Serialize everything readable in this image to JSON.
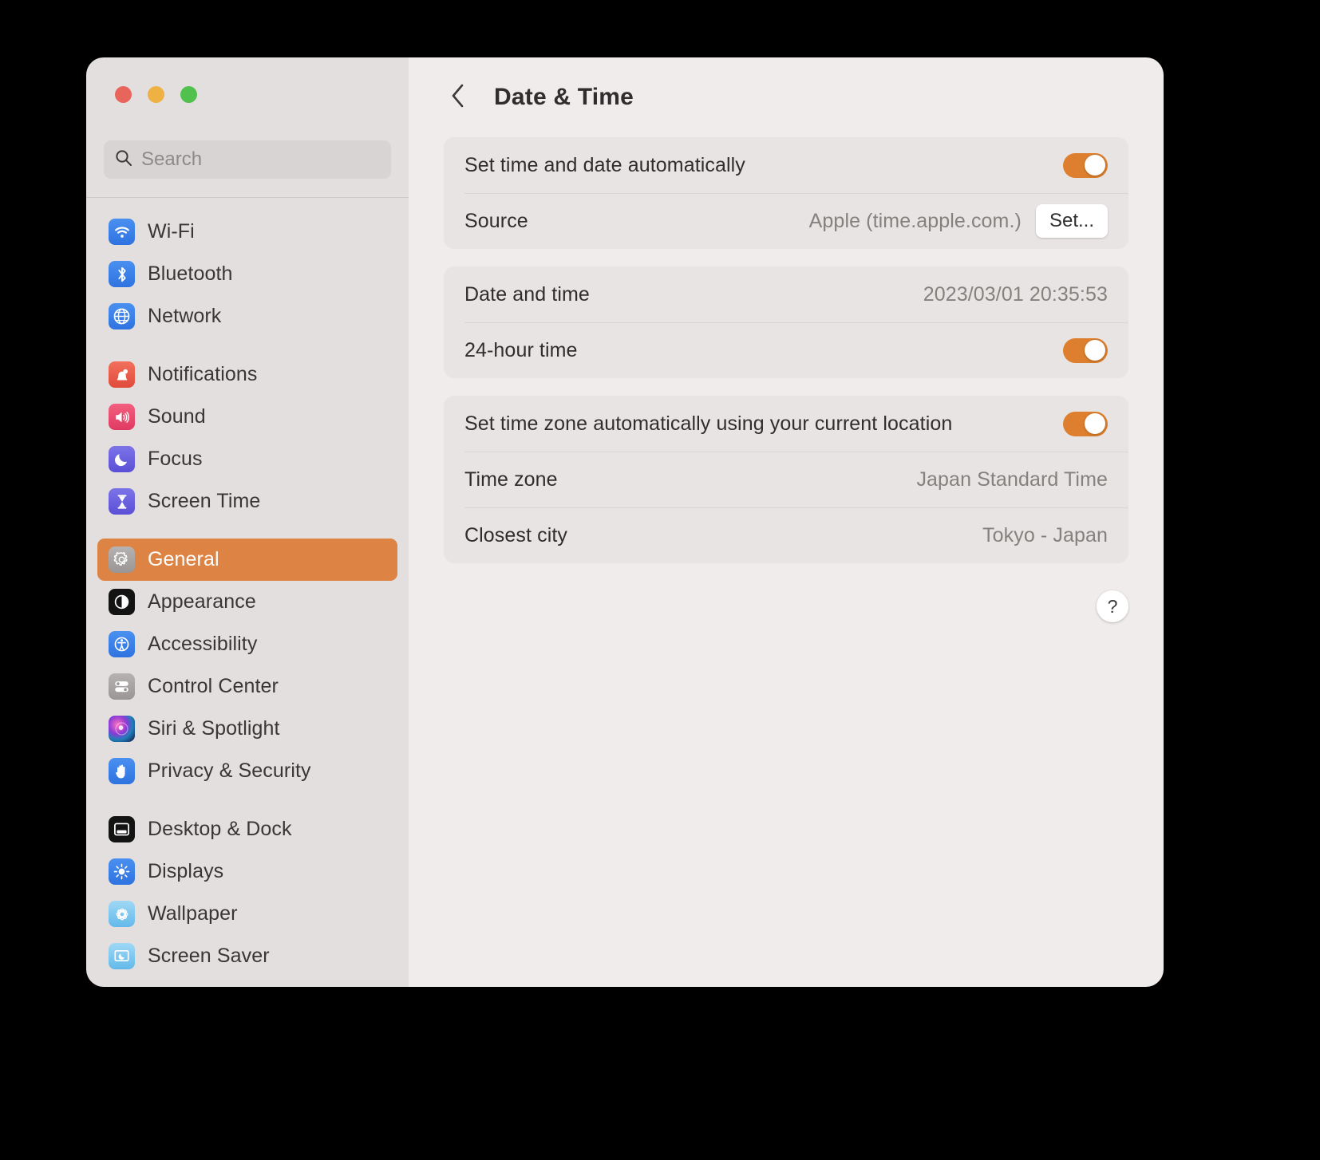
{
  "window": {
    "traffic_lights": [
      {
        "name": "close",
        "color": "#e8655c"
      },
      {
        "name": "minimize",
        "color": "#efb144"
      },
      {
        "name": "zoom",
        "color": "#4fc14c"
      }
    ]
  },
  "search": {
    "placeholder": "Search",
    "value": "",
    "icon": "search-icon"
  },
  "sidebar": {
    "groups": [
      {
        "items": [
          {
            "label": "Wi-Fi",
            "icon": "wifi-icon",
            "selected": false
          },
          {
            "label": "Bluetooth",
            "icon": "bluetooth-icon",
            "selected": false
          },
          {
            "label": "Network",
            "icon": "globe-icon",
            "selected": false
          }
        ]
      },
      {
        "items": [
          {
            "label": "Notifications",
            "icon": "bell-icon",
            "selected": false
          },
          {
            "label": "Sound",
            "icon": "speaker-icon",
            "selected": false
          },
          {
            "label": "Focus",
            "icon": "moon-icon",
            "selected": false
          },
          {
            "label": "Screen Time",
            "icon": "hourglass-icon",
            "selected": false
          }
        ]
      },
      {
        "items": [
          {
            "label": "General",
            "icon": "gear-icon",
            "selected": true
          },
          {
            "label": "Appearance",
            "icon": "appearance-icon",
            "selected": false
          },
          {
            "label": "Accessibility",
            "icon": "accessibility-icon",
            "selected": false
          },
          {
            "label": "Control Center",
            "icon": "control-center-icon",
            "selected": false
          },
          {
            "label": "Siri & Spotlight",
            "icon": "siri-icon",
            "selected": false
          },
          {
            "label": "Privacy & Security",
            "icon": "hand-icon",
            "selected": false
          }
        ]
      },
      {
        "items": [
          {
            "label": "Desktop & Dock",
            "icon": "desktop-dock-icon",
            "selected": false
          },
          {
            "label": "Displays",
            "icon": "brightness-icon",
            "selected": false
          },
          {
            "label": "Wallpaper",
            "icon": "wallpaper-icon",
            "selected": false
          },
          {
            "label": "Screen Saver",
            "icon": "screen-saver-icon",
            "selected": false
          }
        ]
      }
    ]
  },
  "detail": {
    "back_icon": "chevron-left-icon",
    "title": "Date & Time",
    "sections": [
      {
        "rows": [
          {
            "label": "Set time and date automatically",
            "control": "toggle",
            "toggle_on": true
          },
          {
            "label": "Source",
            "value": "Apple (time.apple.com.)",
            "control": "button",
            "button_label": "Set..."
          }
        ]
      },
      {
        "rows": [
          {
            "label": "Date and time",
            "value": "2023/03/01 20:35:53",
            "control": "none"
          },
          {
            "label": "24-hour time",
            "control": "toggle",
            "toggle_on": true
          }
        ]
      },
      {
        "rows": [
          {
            "label": "Set time zone automatically using your current location",
            "control": "toggle",
            "toggle_on": true
          },
          {
            "label": "Time zone",
            "value": "Japan Standard Time",
            "control": "none"
          },
          {
            "label": "Closest city",
            "value": "Tokyo - Japan",
            "control": "none"
          }
        ]
      }
    ],
    "help_label": "?"
  },
  "colors": {
    "accent": "#dd8343",
    "toggle_on": "#dd7f2e",
    "sidebar_bg": "#e4dfdf",
    "detail_bg": "#f0ecec",
    "card_bg": "#e8e4e3"
  }
}
